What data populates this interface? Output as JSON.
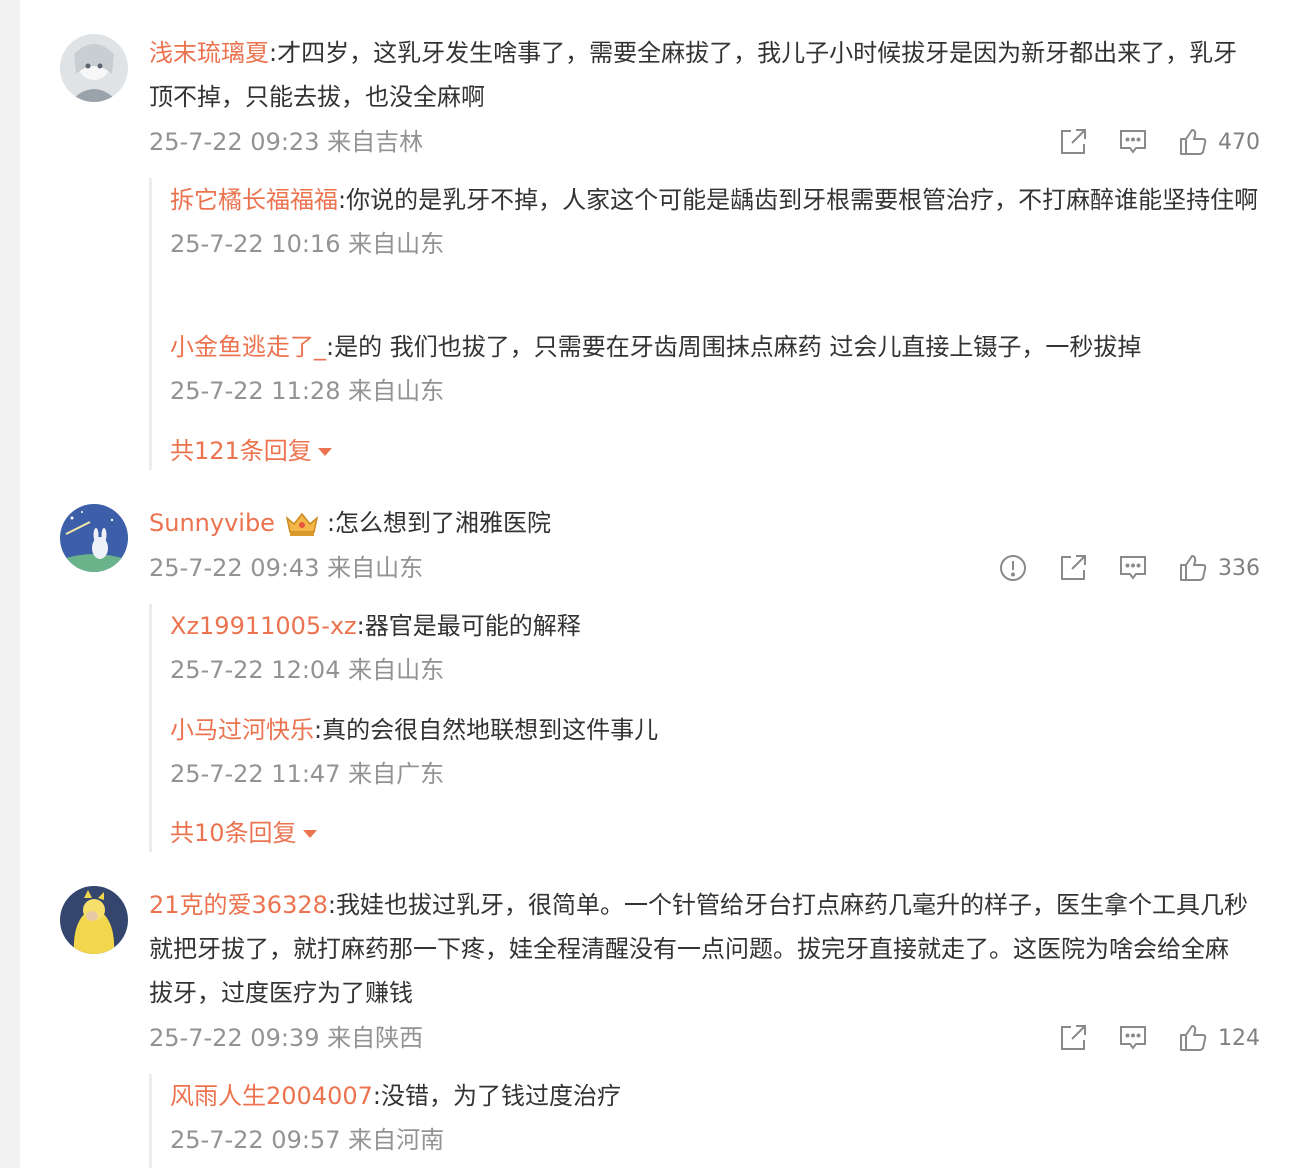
{
  "comments": [
    {
      "user": "浅末琉璃夏",
      "text": ":才四岁，这乳牙发生啥事了，需要全麻拔了，我儿子小时候拔牙是因为新牙都出来了，乳牙顶不掉，只能去拔，也没全麻啊",
      "meta": "25-7-22 09:23 来自吉林",
      "likes": "470",
      "replies": [
        {
          "user": "拆它橘长福福福",
          "text": ":你说的是乳牙不掉，人家这个可能是龋齿到牙根需要根管治疗，不打麻醉谁能坚持住啊",
          "meta": "25-7-22 10:16 来自山东"
        },
        {
          "user": "小金鱼逃走了_",
          "text": ":是的 我们也拔了，只需要在牙齿周围抹点麻药 过会儿直接上镊子，一秒拔掉",
          "meta": "25-7-22 11:28 来自山东"
        }
      ],
      "more": "共121条回复"
    },
    {
      "user": "Sunnyvibe",
      "text": ":怎么想到了湘雅医院",
      "meta": "25-7-22 09:43 来自山东",
      "likes": "336",
      "replies": [
        {
          "user": "Xz19911005-xz",
          "text": ":器官是最可能的解释",
          "meta": "25-7-22 12:04 来自山东"
        },
        {
          "user": "小马过河快乐",
          "text": ":真的会很自然地联想到这件事儿",
          "meta": "25-7-22 11:47 来自广东"
        }
      ],
      "more": "共10条回复"
    },
    {
      "user": "21克的爱36328",
      "text": ":我娃也拔过乳牙，很简单。一个针管给牙台打点麻药几毫升的样子，医生拿个工具几秒就把牙拔了，就打麻药那一下疼，娃全程清醒没有一点问题。拔完牙直接就走了。这医院为啥会给全麻拔牙，过度医疗为了赚钱",
      "meta": "25-7-22 09:39 来自陕西",
      "likes": "124",
      "replies": [
        {
          "user": "风雨人生2004007",
          "text": ":没错，为了钱过度治疗",
          "meta": "25-7-22 09:57 来自河南"
        }
      ]
    }
  ],
  "colors": {
    "username": "#eb7350",
    "meta": "#939393",
    "text": "#333333",
    "icon": "#8a8a8a"
  }
}
